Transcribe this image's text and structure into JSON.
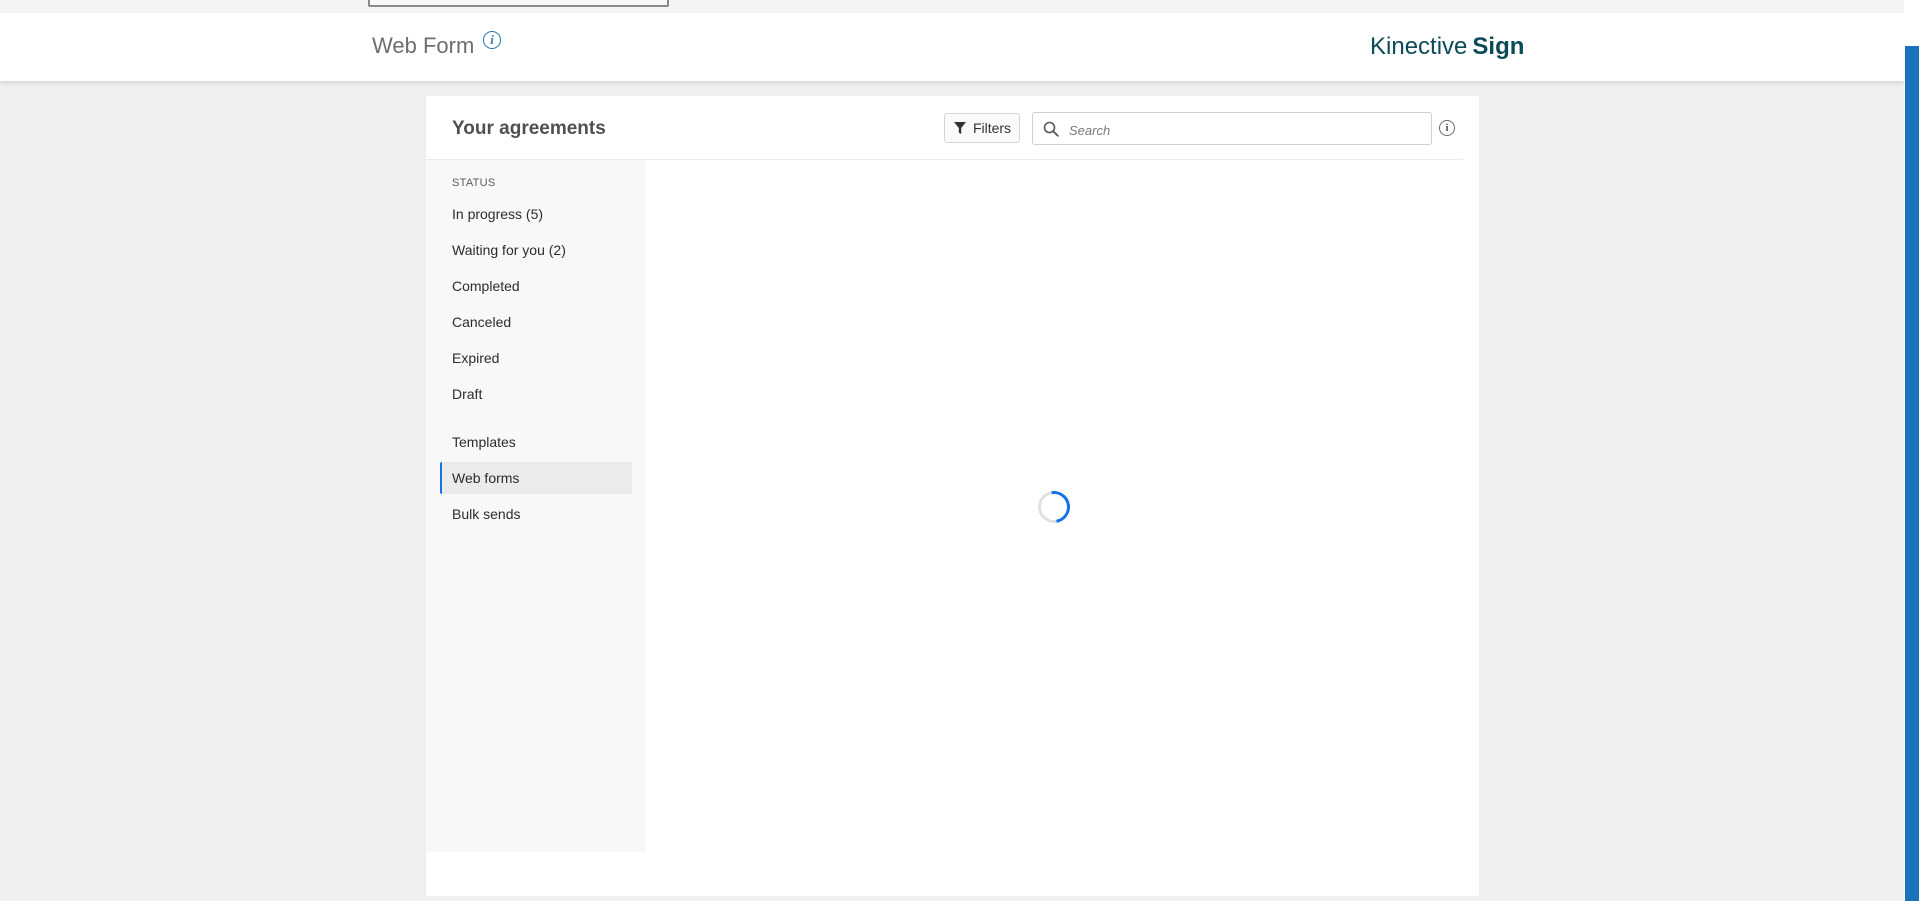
{
  "header": {
    "title": "Web Form",
    "info_icon": "info-icon",
    "brand_light": "Kinective",
    "brand_bold": "Sign"
  },
  "card": {
    "title": "Your agreements",
    "filters_label": "Filters",
    "search_placeholder": "Search"
  },
  "sidebar": {
    "status_heading": "STATUS",
    "status_items": [
      {
        "label": "In progress (5)"
      },
      {
        "label": "Waiting for you (2)"
      },
      {
        "label": "Completed"
      },
      {
        "label": "Canceled"
      },
      {
        "label": "Expired"
      },
      {
        "label": "Draft"
      }
    ],
    "other_items": [
      {
        "label": "Templates"
      },
      {
        "label": "Web forms",
        "active": true
      },
      {
        "label": "Bulk sends"
      }
    ]
  },
  "colors": {
    "accent": "#1473e6",
    "brand": "#0b4a56",
    "scroll_thumb": "#1b73bd"
  },
  "content": {
    "state": "loading",
    "spinner_icon": "loading-spinner-icon"
  }
}
